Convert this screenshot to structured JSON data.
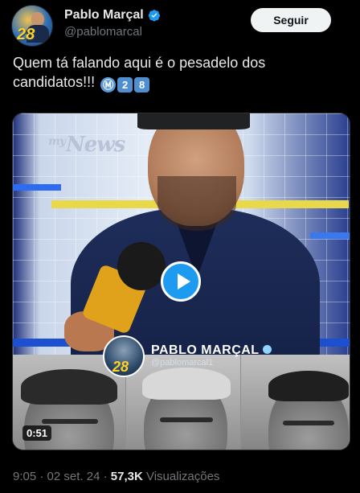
{
  "author": {
    "name": "Pablo Marçal",
    "handle": "@pablomarcal",
    "avatar_number": "28"
  },
  "follow_button": {
    "label": "Seguir"
  },
  "tweet": {
    "text": "Quem tá falando aqui é o pesadelo dos candidatos!!!",
    "emojis": [
      "Ⓜ",
      "2",
      "8"
    ]
  },
  "video": {
    "logo_text": "News",
    "logo_prefix": "my",
    "banner": {
      "name": "PABLO MARÇAL",
      "handle": "@pablomarcal1",
      "avatar_number": "28"
    },
    "duration": "0:51"
  },
  "meta": {
    "time": "9:05",
    "separator1": "·",
    "date": "02 set. 24",
    "separator2": "·",
    "views_count": "57,3K",
    "views_label": "Visualizações"
  },
  "colors": {
    "accent": "#1d9bf0",
    "background": "#000000",
    "text_primary": "#e7e9ea",
    "text_secondary": "#71767b"
  }
}
